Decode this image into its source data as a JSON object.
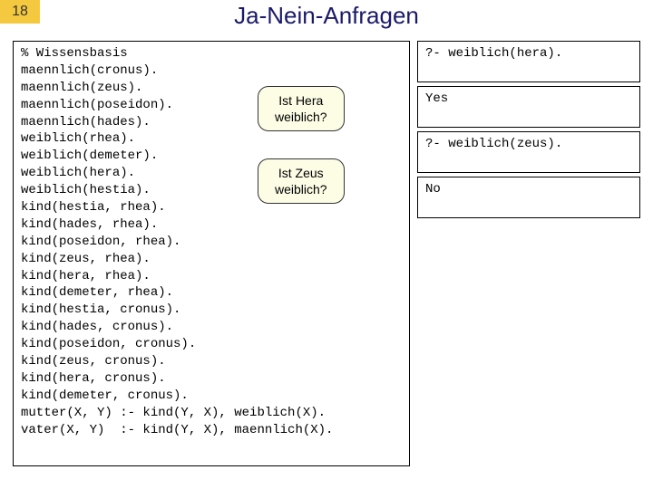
{
  "slide_number": "18",
  "title": "Ja-Nein-Anfragen",
  "knowledge_base": "% Wissensbasis\nmaennlich(cronus).\nmaennlich(zeus).\nmaennlich(poseidon).\nmaennlich(hades).\nweiblich(rhea).\nweiblich(demeter).\nweiblich(hera).\nweiblich(hestia).\nkind(hestia, rhea).\nkind(hades, rhea).\nkind(poseidon, rhea).\nkind(zeus, rhea).\nkind(hera, rhea).\nkind(demeter, rhea).\nkind(hestia, cronus).\nkind(hades, cronus).\nkind(poseidon, cronus).\nkind(zeus, cronus).\nkind(hera, cronus).\nkind(demeter, cronus).\nmutter(X, Y) :- kind(Y, X), weiblich(X).\nvater(X, Y)  :- kind(Y, X), maennlich(X).",
  "callouts": {
    "c1_line1": "Ist Hera",
    "c1_line2": "weiblich?",
    "c2_line1": "Ist Zeus",
    "c2_line2": "weiblich?"
  },
  "queries": {
    "q1": "?- weiblich(hera).",
    "r1": "Yes",
    "q2": "?- weiblich(zeus).",
    "r2": "No"
  }
}
